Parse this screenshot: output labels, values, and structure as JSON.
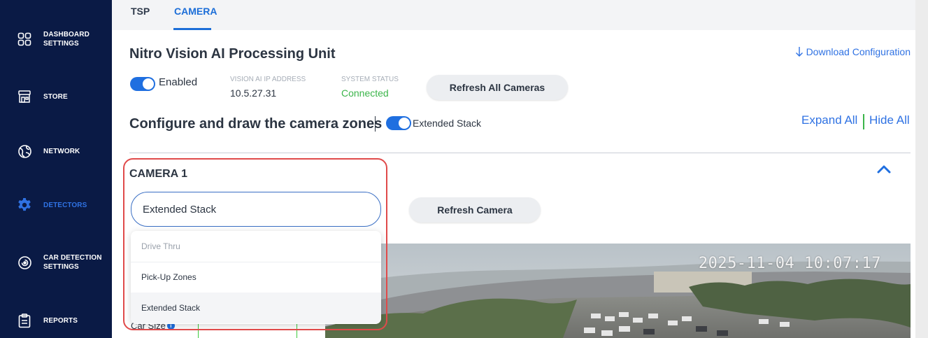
{
  "sidebar": {
    "items": [
      {
        "label_line1": "DASHBOARD",
        "label_line2": "SETTINGS",
        "icon": "dashboard-grid-icon",
        "active": false
      },
      {
        "label_line1": "STORE",
        "label_line2": "",
        "icon": "store-icon",
        "active": false
      },
      {
        "label_line1": "NETWORK",
        "label_line2": "",
        "icon": "network-globe-icon",
        "active": false
      },
      {
        "label_line1": "DETECTORS",
        "label_line2": "",
        "icon": "gear-icon",
        "active": true
      },
      {
        "label_line1": "CAR DETECTION",
        "label_line2": "SETTINGS",
        "icon": "radar-target-icon",
        "active": false
      },
      {
        "label_line1": "REPORTS",
        "label_line2": "",
        "icon": "clipboard-icon",
        "active": false
      }
    ]
  },
  "tabs": [
    {
      "label": "TSP",
      "active": false
    },
    {
      "label": "CAMERA",
      "active": true
    }
  ],
  "header": {
    "title": "Nitro Vision AI Processing Unit",
    "download_label": "Download Configuration",
    "download_icon": "arrow-down-icon"
  },
  "status": {
    "enabled_label": "Enabled",
    "enabled": true,
    "ip_label": "VISION AI IP ADDRESS",
    "ip_value": "10.5.27.31",
    "system_status_label": "SYSTEM STATUS",
    "system_status_value": "Connected",
    "refresh_all_label": "Refresh All Cameras"
  },
  "zones": {
    "configure_title": "Configure and draw the camera zones",
    "extended_stack_label": "Extended Stack",
    "extended_stack_enabled": true,
    "expand_all_label": "Expand All",
    "hide_all_label": "Hide All"
  },
  "camera": {
    "title": "CAMERA 1",
    "select_value": "Extended Stack",
    "refresh_label": "Refresh Camera",
    "options": [
      {
        "label": "Drive Thru",
        "disabled": true
      },
      {
        "label": "Pick-Up Zones",
        "disabled": false
      },
      {
        "label": "Extended Stack",
        "disabled": false,
        "selected": true
      }
    ],
    "car_size_label": "Car Size",
    "timestamp": "2025-11-04 10:07:17"
  },
  "colors": {
    "sidebar_bg": "#0a1a45",
    "accent": "#1f6fe0",
    "status_green": "#3bb54a",
    "highlight_red": "#e04a4a"
  }
}
